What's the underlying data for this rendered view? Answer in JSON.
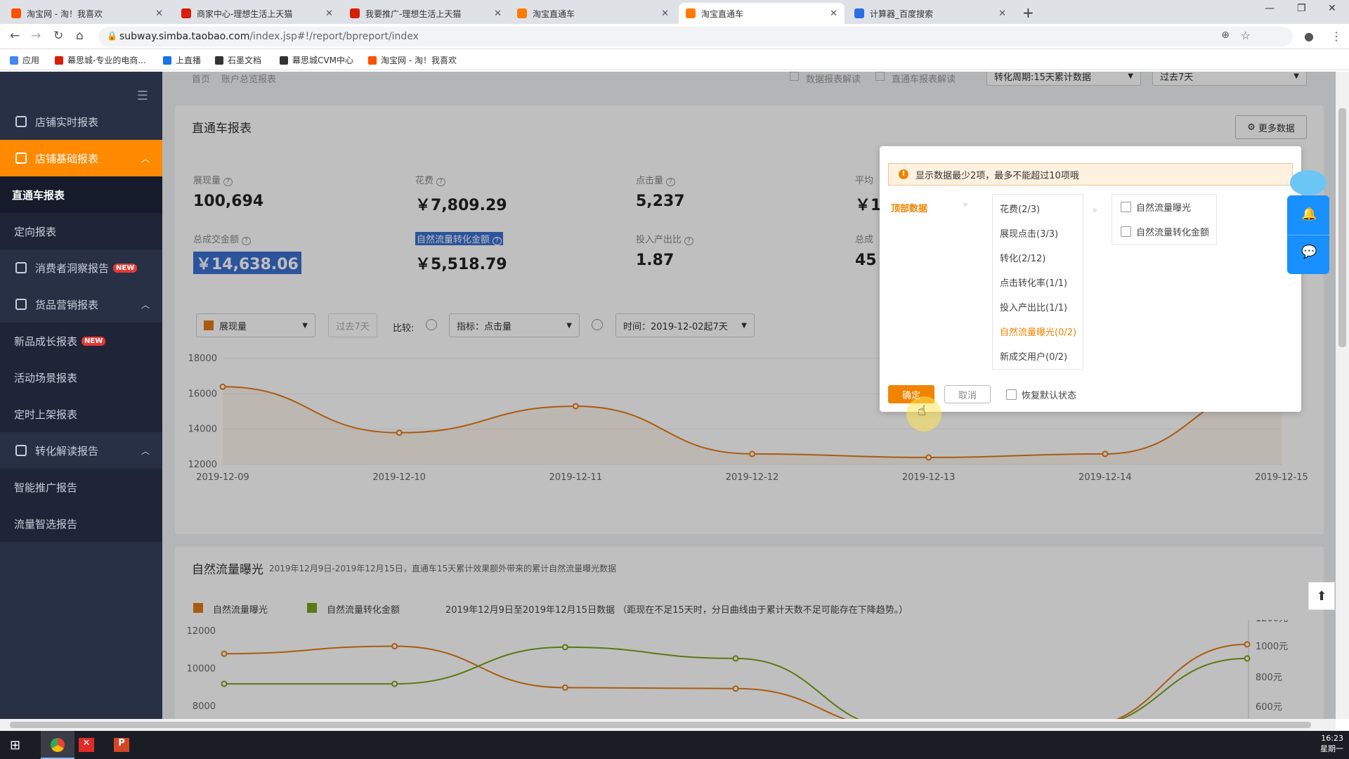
{
  "browser": {
    "tabs": [
      {
        "title": "淘宝网 - 淘！我喜欢",
        "icon": "taobao-icon",
        "color": "#ff5000"
      },
      {
        "title": "商家中心-理想生活上天猫",
        "icon": "tmall-icon",
        "color": "#d81e06"
      },
      {
        "title": "我要推广-理想生活上天猫",
        "icon": "tmall-icon",
        "color": "#d81e06"
      },
      {
        "title": "淘宝直通车",
        "icon": "ztc-icon",
        "color": "#ff7a00"
      },
      {
        "title": "淘宝直通车",
        "icon": "ztc-icon",
        "color": "#ff7a00"
      },
      {
        "title": "计算器_百度搜索",
        "icon": "baidu-icon",
        "color": "#2b6de4"
      }
    ],
    "url_host": "subway.simba.taobao.com",
    "url_path": "/index.jsp#!/report/bpreport/index",
    "bookmarks": [
      "应用",
      "幕思城-专业的电商...",
      "上直播",
      "石墨文档",
      "幕思城CVM中心",
      "淘宝网 - 淘！我喜欢"
    ]
  },
  "sidebar": {
    "items": [
      {
        "label": "店铺实时报表",
        "type": "parent"
      },
      {
        "label": "店铺基础报表",
        "type": "active-parent"
      },
      {
        "label": "直通车报表",
        "type": "current"
      },
      {
        "label": "定向报表",
        "type": "sub"
      },
      {
        "label": "消费者洞察报告",
        "type": "parent",
        "badge": "NEW"
      },
      {
        "label": "货品营销报表",
        "type": "parent"
      },
      {
        "label": "新品成长报表",
        "type": "sub",
        "badge": "NEW"
      },
      {
        "label": "活动场景报表",
        "type": "sub"
      },
      {
        "label": "定时上架报表",
        "type": "sub"
      },
      {
        "label": "转化解读报告",
        "type": "parent"
      },
      {
        "label": "智能推广报告",
        "type": "sub"
      },
      {
        "label": "流量智选报告",
        "type": "sub"
      }
    ]
  },
  "topbar": {
    "breadcrumb_home": "首页",
    "breadcrumb_current": "账户总览报表",
    "check1": "数据报表解读",
    "check2": "直通车报表解读",
    "period_select": "转化周期:15天累计数据",
    "range_select": "过去7天"
  },
  "report": {
    "title": "直通车报表",
    "more_button": "更多数据",
    "metrics": [
      {
        "label": "展现量",
        "value": "100,694"
      },
      {
        "label": "花费",
        "value": "￥7,809.29"
      },
      {
        "label": "点击量",
        "value": "5,237"
      },
      {
        "label": "平均",
        "value": "￥1"
      },
      {
        "label": "总成交金额",
        "value": "￥14,638.06"
      },
      {
        "label": "自然流量转化金额",
        "value": "￥5,518.79"
      },
      {
        "label": "投入产出比",
        "value": "1.87"
      },
      {
        "label": "总成",
        "value": "45"
      }
    ],
    "controls": {
      "metric_select": "展现量",
      "range": "过去7天",
      "compare_label": "比较:",
      "index_select": "指标：点击量",
      "time_select": "时间：2019-12-02起7天"
    }
  },
  "popup": {
    "warning": "显示数据最少2项，最多不能超过10项哦",
    "top_label": "顶部数据",
    "categories": [
      "花费(2/3)",
      "展现点击(3/3)",
      "转化(2/12)",
      "点击转化率(1/1)",
      "投入产出比(1/1)",
      "自然流量曝光(0/2)",
      "新成交用户(0/2)"
    ],
    "active_category": 5,
    "options": [
      "自然流量曝光",
      "自然流量转化金额"
    ],
    "ok": "确定",
    "cancel": "取消",
    "restore": "恢复默认状态"
  },
  "chart_data": [
    {
      "type": "area",
      "x": [
        "2019-12-09",
        "2019-12-10",
        "2019-12-11",
        "2019-12-12",
        "2019-12-13",
        "2019-12-14",
        "2019-12-15"
      ],
      "series": [
        {
          "values": [
            16400,
            13800,
            15300,
            12600,
            12400,
            12600,
            16500
          ]
        }
      ],
      "yticks": [
        "18000",
        "16000",
        "14000",
        "12000"
      ],
      "ylim": [
        12000,
        18000
      ],
      "color": "#e07b18"
    },
    {
      "type": "line",
      "title": "自然流量曝光",
      "subtitle": "2019年12月9日-2019年12月15日，直通车15天累计效果额外带来的累计自然流量曝光数据",
      "note": "2019年12月9日至2019年12月15日数据 （距现在不足15天时，分日曲线由于累计天数不足可能存在下降趋势。）",
      "series": [
        {
          "name": "自然流量曝光",
          "color": "#e07b18",
          "values": [
            10800,
            11200,
            9000,
            8950,
            6800,
            6900,
            11300
          ]
        },
        {
          "name": "自然流量转化金额",
          "color": "#7aa11b",
          "values": [
            9200,
            9200,
            11150,
            10550,
            6800,
            6900,
            10550
          ]
        }
      ],
      "yticks_left": [
        "12000",
        "10000",
        "8000"
      ],
      "yticks_right": [
        "1200元",
        "1000元",
        "800元",
        "600元"
      ],
      "ylim": [
        7000,
        12600
      ]
    }
  ],
  "taskbar": {
    "time": "16:23",
    "day": "星期一"
  },
  "colors": {
    "accent": "#ff8a00",
    "sidebar": "#273045"
  }
}
